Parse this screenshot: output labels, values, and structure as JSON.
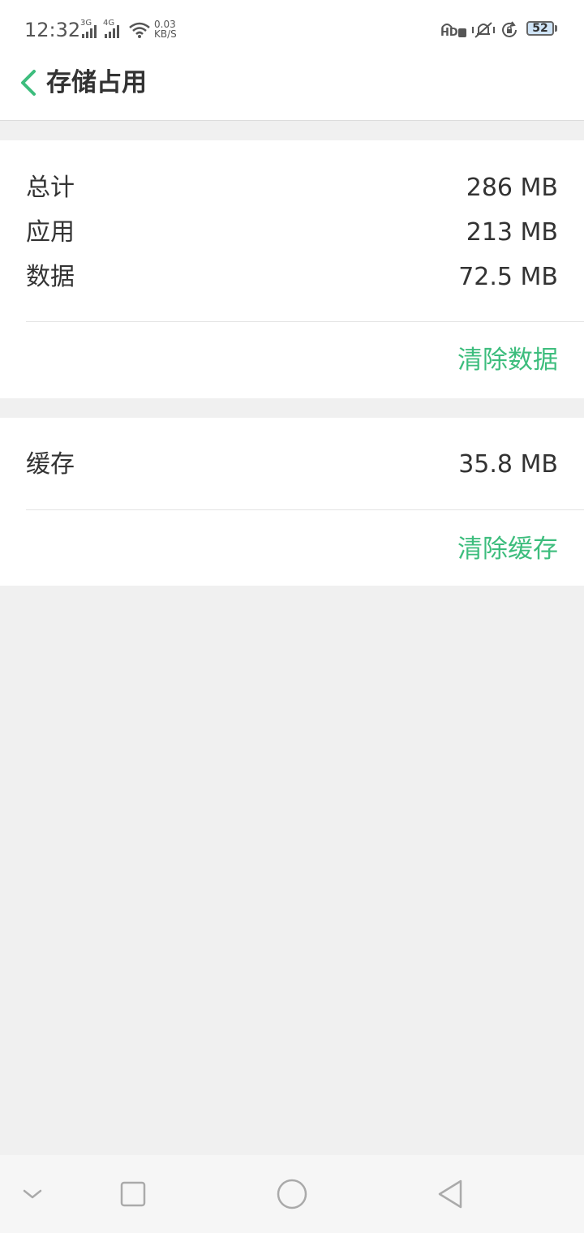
{
  "status_bar": {
    "time": "12:32",
    "network_1": "3G",
    "network_2": "4G",
    "speed_value": "0.03",
    "speed_unit": "KB/S",
    "hd_label": "HD",
    "battery": "52",
    "icons": [
      "signal-icon",
      "wifi-icon",
      "hd-voice-icon",
      "vibrate-icon",
      "rotation-lock-icon",
      "battery-icon"
    ]
  },
  "header": {
    "title": "存储占用",
    "back_icon": "chevron-left-icon"
  },
  "storage": {
    "rows": [
      {
        "label": "总计",
        "value": "286 MB"
      },
      {
        "label": "应用",
        "value": "213 MB"
      },
      {
        "label": "数据",
        "value": "72.5 MB"
      }
    ],
    "clear_label": "清除数据"
  },
  "cache": {
    "label": "缓存",
    "value": "35.8 MB",
    "clear_label": "清除缓存"
  },
  "nav": {
    "icons": [
      "chevron-down-icon",
      "recents-square-icon",
      "home-circle-icon",
      "back-triangle-icon"
    ]
  },
  "colors": {
    "accent": "#3dbd7d",
    "background": "#f0f0f0",
    "text": "#333333"
  }
}
